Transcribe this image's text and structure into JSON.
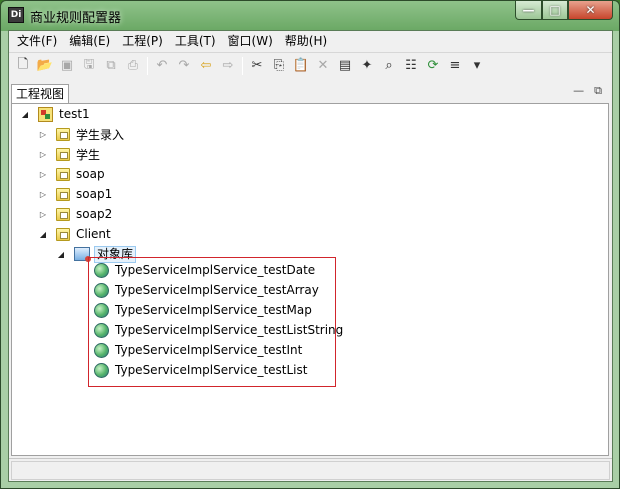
{
  "window": {
    "title": "商业规则配置器",
    "app_icon_glyph": "Di",
    "controls": {
      "minimize": "—",
      "maximize": "□",
      "close": "✕"
    }
  },
  "menubar": {
    "items": [
      "文件(F)",
      "编辑(E)",
      "工程(P)",
      "工具(T)",
      "窗口(W)",
      "帮助(H)"
    ]
  },
  "toolbar": {
    "icons": [
      "new-file-icon",
      "open-folder-icon",
      "open-project-icon",
      "save-icon",
      "save-all-icon",
      "print-icon",
      "undo-icon",
      "redo-icon",
      "back-arrow-icon",
      "forward-arrow-icon",
      "cut-icon",
      "copy-icon",
      "paste-icon",
      "delete-icon",
      "properties-icon",
      "wand-icon",
      "find-icon",
      "config-icon",
      "refresh-icon",
      "indent-icon",
      "dropdown-icon"
    ]
  },
  "tab": {
    "label": "工程视图",
    "minimize": "—",
    "restore": "⧉"
  },
  "tree": {
    "root": {
      "label": "test1"
    },
    "folders": [
      "学生录入",
      "学生",
      "soap",
      "soap1",
      "soap2"
    ],
    "client": {
      "label": "Client"
    },
    "object_library": {
      "label": "对象库"
    },
    "services": [
      "TypeServiceImplService_testDate",
      "TypeServiceImplService_testArray",
      "TypeServiceImplService_testMap",
      "TypeServiceImplService_testListString",
      "TypeServiceImplService_testInt",
      "TypeServiceImplService_testList"
    ]
  },
  "colors": {
    "title_gradient_top": "#8fc28a",
    "selection_border": "#d1252c",
    "client_bg": "#f0f0f0"
  }
}
